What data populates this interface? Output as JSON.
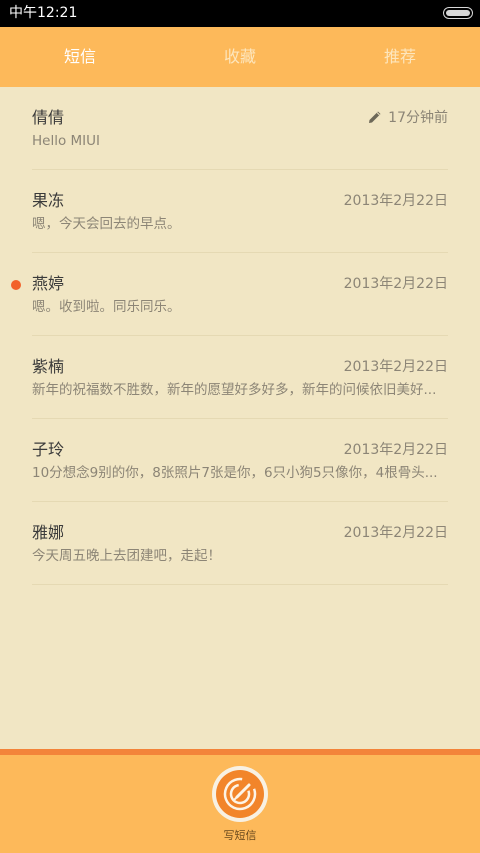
{
  "status_bar": {
    "time": "中午12:21"
  },
  "tabs": [
    {
      "label": "短信",
      "active": true
    },
    {
      "label": "收藏",
      "active": false
    },
    {
      "label": "推荐",
      "active": false
    }
  ],
  "messages": [
    {
      "name": "倩倩",
      "preview": "Hello MIUI",
      "date": "17分钟前",
      "draft": true,
      "unread": false
    },
    {
      "name": "果冻",
      "preview": "嗯，今天会回去的早点。",
      "date": "2013年2月22日",
      "draft": false,
      "unread": false
    },
    {
      "name": "燕婷",
      "preview": "嗯。收到啦。同乐同乐。",
      "date": "2013年2月22日",
      "draft": false,
      "unread": true
    },
    {
      "name": "紫楠",
      "preview": "新年的祝福数不胜数，新年的愿望好多好多，新年的问候依旧美好...",
      "date": "2013年2月22日",
      "draft": false,
      "unread": false
    },
    {
      "name": "子玲",
      "preview": "10分想念9别的你，8张照片7张是你，6只小狗5只像你，4根骨头...",
      "date": "2013年2月22日",
      "draft": false,
      "unread": false
    },
    {
      "name": "雅娜",
      "preview": "今天周五晚上去团建吧，走起！",
      "date": "2013年2月22日",
      "draft": false,
      "unread": false
    }
  ],
  "bottom_bar": {
    "compose_label": "写短信",
    "compose_icon": "compose-icon"
  },
  "colors": {
    "accent": "#fdb95a",
    "background": "#f1e6c4",
    "unread": "#f2622a",
    "compose_button": "#f2852a"
  }
}
